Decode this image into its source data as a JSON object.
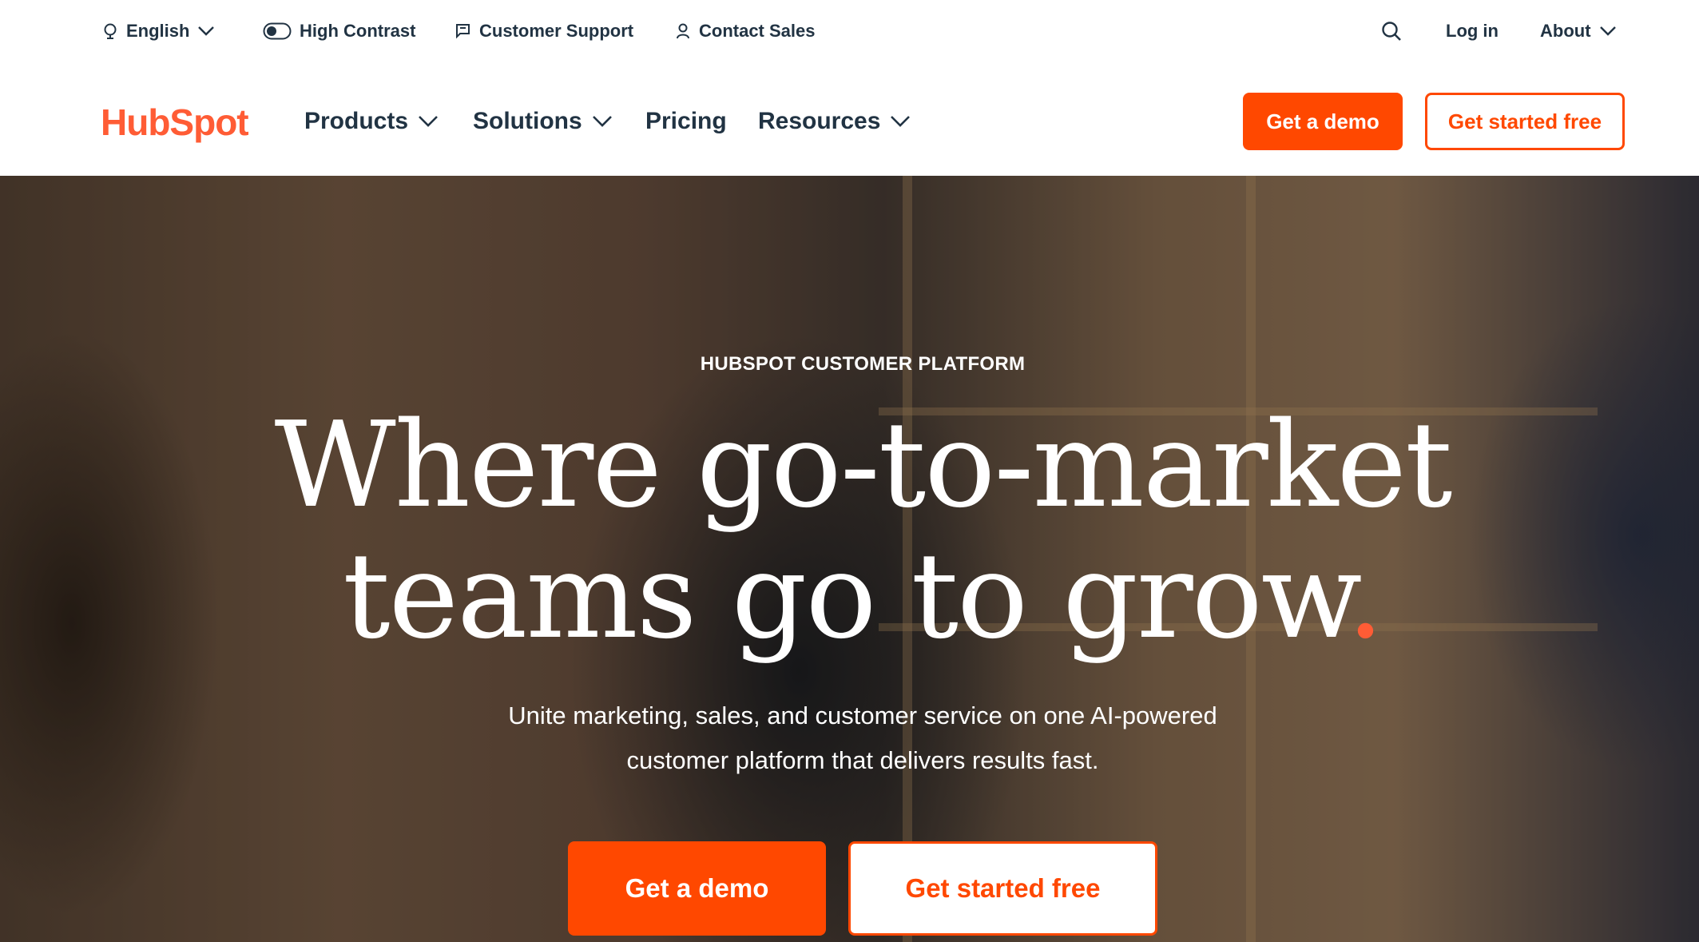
{
  "utility_bar": {
    "language": "English",
    "high_contrast": "High Contrast",
    "customer_support": "Customer Support",
    "contact_sales": "Contact Sales",
    "log_in": "Log in",
    "about": "About"
  },
  "nav": {
    "logo": "HubSpot",
    "items": [
      {
        "label": "Products",
        "dropdown": true
      },
      {
        "label": "Solutions",
        "dropdown": true
      },
      {
        "label": "Pricing",
        "dropdown": false
      },
      {
        "label": "Resources",
        "dropdown": true
      }
    ],
    "demo_button": "Get a demo",
    "free_button": "Get started free"
  },
  "hero": {
    "eyebrow": "HUBSPOT CUSTOMER PLATFORM",
    "headline_line1": "Where go-to-market",
    "headline_line2": "teams go to grow",
    "headline_dot": ".",
    "subtext_line1": "Unite marketing, sales, and customer service on one AI-powered",
    "subtext_line2": "customer platform that delivers results fast.",
    "demo_button": "Get a demo",
    "free_button": "Get started free"
  },
  "colors": {
    "brand_orange": "#ff4800",
    "logo_orange": "#ff5c35",
    "text_dark": "#213343"
  }
}
